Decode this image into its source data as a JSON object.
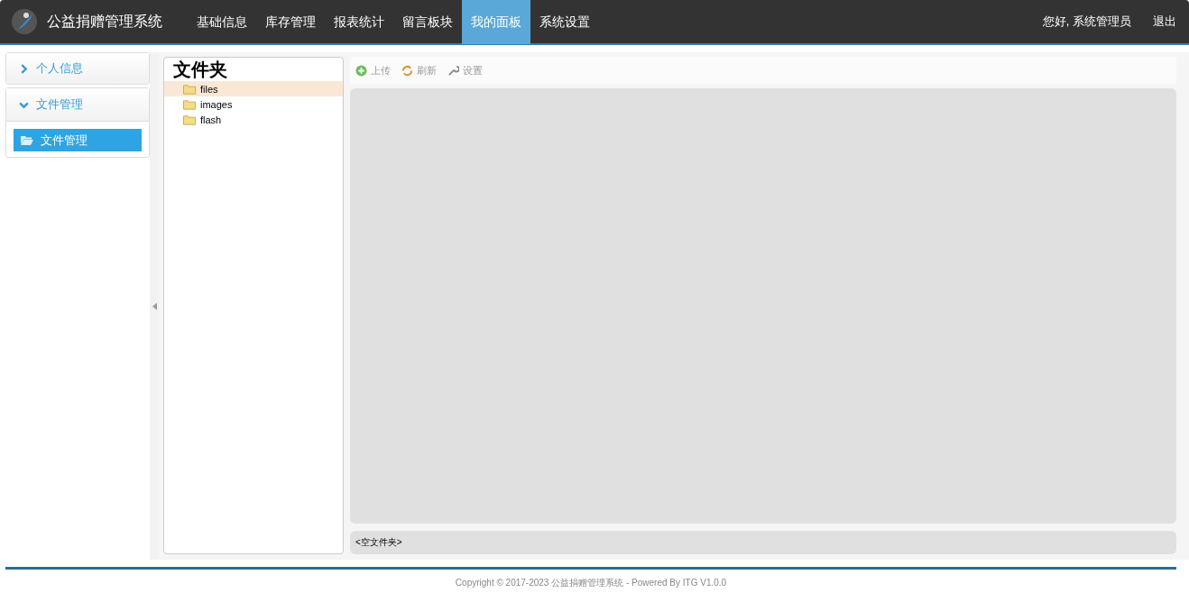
{
  "header": {
    "app_title": "公益捐赠管理系统",
    "nav": [
      {
        "label": "基础信息",
        "selected": false
      },
      {
        "label": "库存管理",
        "selected": false
      },
      {
        "label": "报表统计",
        "selected": false
      },
      {
        "label": "留言板块",
        "selected": false
      },
      {
        "label": "我的面板",
        "selected": true
      },
      {
        "label": "系统设置",
        "selected": false
      }
    ],
    "greeting": "您好, 系统管理员",
    "logout": "退出"
  },
  "sidebar": {
    "groups": [
      {
        "title": "个人信息",
        "expanded": false
      },
      {
        "title": "文件管理",
        "expanded": true,
        "items": [
          {
            "label": "文件管理",
            "selected": true
          }
        ]
      }
    ]
  },
  "folder_panel": {
    "title": "文件夹",
    "folders": [
      {
        "name": "files",
        "selected": true
      },
      {
        "name": "images",
        "selected": false
      },
      {
        "name": "flash",
        "selected": false
      }
    ]
  },
  "toolbar": [
    {
      "kind": "upload",
      "label": "上传"
    },
    {
      "kind": "refresh",
      "label": "刷新"
    },
    {
      "kind": "settings",
      "label": "设置"
    }
  ],
  "status_bar": "<空文件夹>",
  "footer": "Copyright © 2017-2023 公益捐赠管理系统 - Powered By ITG V1.0.0"
}
